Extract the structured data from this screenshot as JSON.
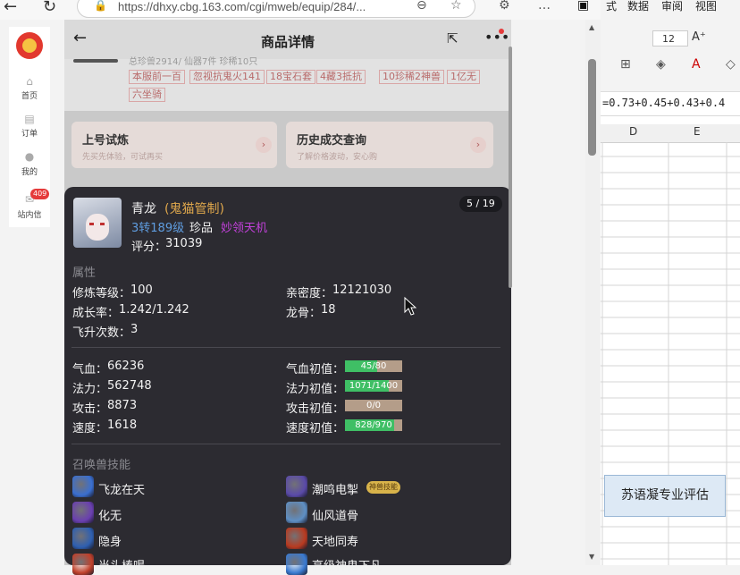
{
  "browser": {
    "url": "https://dhxy.cbg.163.com/cgi/mweb/equip/284/..."
  },
  "excel": {
    "tabs": [
      "式",
      "数据",
      "审阅",
      "视图"
    ],
    "font_size": "12",
    "formula": "=0.73+0.45+0.43+0.4",
    "columns": [
      "D",
      "E"
    ],
    "cell_text": "苏语凝专业评估"
  },
  "sidebar": {
    "items": [
      {
        "label": "首页"
      },
      {
        "label": "订单"
      },
      {
        "label": "我的"
      },
      {
        "label": "站内信"
      }
    ],
    "badge": "409"
  },
  "header": {
    "title": "商品详情"
  },
  "tags_top_line": "总珍兽2914/ 仙器7件 珍稀10只",
  "tags": [
    "本服前一百",
    "忽视抗鬼火141",
    "18宝石套",
    "4藏3抵抗",
    "10珍稀2神兽",
    "1亿无",
    "六坐骑"
  ],
  "cards": [
    {
      "title": "上号试炼",
      "sub": "先买先体验，可试再买"
    },
    {
      "title": "历史成交查询",
      "sub": "了解价格波动，安心购"
    }
  ],
  "pet": {
    "name": "青龙",
    "owner": "(鬼猫管制)",
    "level": "3转189级",
    "grade": "珍品",
    "skill_tag": "妙领天机",
    "score_label": "评分：",
    "score": "31039",
    "page": "5 / 19",
    "sections": {
      "attributes": "属性",
      "skills": "召唤兽技能"
    },
    "attrs": [
      {
        "label": "修炼等级：",
        "value": "100"
      },
      {
        "label": "亲密度：",
        "value": "12121030"
      },
      {
        "label": "成长率：",
        "value": "1.242/1.242"
      },
      {
        "label": "龙骨：",
        "value": "18"
      },
      {
        "label": "飞升次数：",
        "value": "3"
      }
    ],
    "stats": [
      {
        "label": "气血：",
        "value": "66236",
        "init_label": "气血初值：",
        "init": "45/80",
        "ratio": 0.5625
      },
      {
        "label": "法力：",
        "value": "562748",
        "init_label": "法力初值：",
        "init": "1071/1400",
        "ratio": 0.765
      },
      {
        "label": "攻击：",
        "value": "8873",
        "init_label": "攻击初值：",
        "init": "0/0",
        "ratio": 0
      },
      {
        "label": "速度：",
        "value": "1618",
        "init_label": "速度初值：",
        "init": "828/970",
        "ratio": 0.8536
      }
    ],
    "skills": [
      {
        "name": "飞龙在天",
        "color": "#3a6fd0"
      },
      {
        "name": "潮鸣电掣",
        "color": "#5a4aa8",
        "badge": "神兽技能"
      },
      {
        "name": "化无",
        "color": "#6a3fb0"
      },
      {
        "name": "仙风道骨",
        "color": "#5e8fc4"
      },
      {
        "name": "隐身",
        "color": "#2e5fb0"
      },
      {
        "name": "天地同寿",
        "color": "#b83a20"
      },
      {
        "name": "当头棒喝",
        "color": "#c0402a"
      },
      {
        "name": "高级神鬼下凡",
        "color": "#3a7ad0"
      }
    ]
  }
}
